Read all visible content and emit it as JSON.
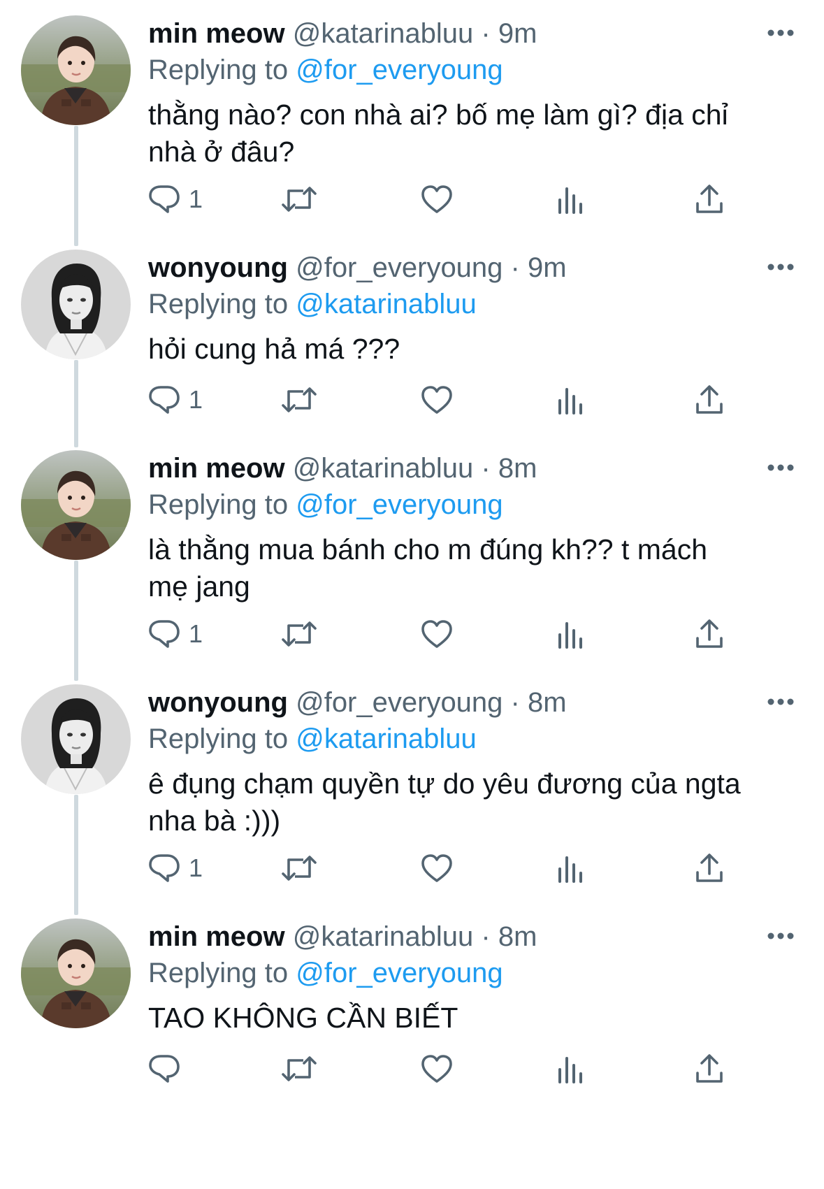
{
  "tweets": [
    {
      "name": "min meow",
      "handle": "@katarinabluu",
      "time": "9m",
      "replying_prefix": "Replying to",
      "replying_to": "@for_everyoung",
      "text_lines": [
        "thằng nào? con nhà ai? bố mẹ làm gì? địa chỉ",
        "nhà ở đâu?"
      ],
      "reply_count": "1",
      "avatar": "toddler-photo-avatar"
    },
    {
      "name": "wonyoung",
      "handle": "@for_everyoung",
      "time": "9m",
      "replying_prefix": "Replying to",
      "replying_to": "@katarinabluu",
      "text_lines": [
        "hỏi cung hả má ???"
      ],
      "reply_count": "1",
      "avatar": "portrait-photo-avatar"
    },
    {
      "name": "min meow",
      "handle": "@katarinabluu",
      "time": "8m",
      "replying_prefix": "Replying to",
      "replying_to": "@for_everyoung",
      "text_lines": [
        "là thằng mua bánh cho m đúng kh?? t mách",
        "mẹ jang"
      ],
      "reply_count": "1",
      "avatar": "toddler-photo-avatar"
    },
    {
      "name": "wonyoung",
      "handle": "@for_everyoung",
      "time": "8m",
      "replying_prefix": "Replying to",
      "replying_to": "@katarinabluu",
      "text_lines": [
        "ê đụng chạm quyền tự do yêu đương của ngta",
        "nha bà :)))"
      ],
      "reply_count": "1",
      "avatar": "portrait-photo-avatar"
    },
    {
      "name": "min meow",
      "handle": "@katarinabluu",
      "time": "8m",
      "replying_prefix": "Replying to",
      "replying_to": "@for_everyoung",
      "text_lines": [
        "TAO KHÔNG CẦN BIẾT"
      ],
      "reply_count": "",
      "avatar": "toddler-photo-avatar"
    }
  ],
  "separator": "·",
  "icons": {
    "reply": "reply-icon",
    "retweet": "retweet-icon",
    "like": "heart-icon",
    "views": "views-icon",
    "share": "share-icon",
    "more": "more-icon"
  },
  "colors": {
    "name": "#0f1419",
    "secondary": "#536471",
    "mention": "#1d9bf0",
    "thread_line": "#cfd9de"
  }
}
